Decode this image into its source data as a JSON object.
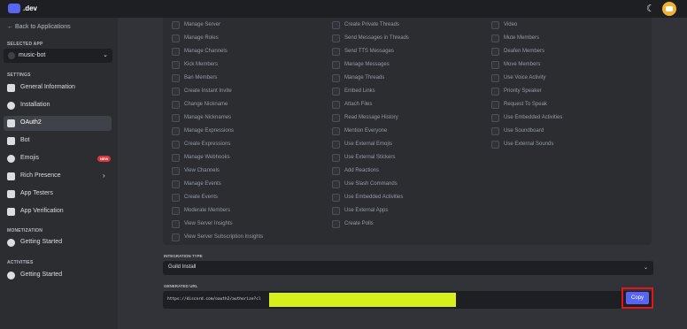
{
  "brand": {
    "logo_text": ".dev"
  },
  "header": {
    "theme_icon": "moon-icon",
    "avatar_icon": "avatar"
  },
  "sidebar": {
    "back_label": "← Back to Applications",
    "selected_app_label": "SELECTED APP",
    "selected_app": "music-bot",
    "settings_label": "SETTINGS",
    "settings_items": [
      {
        "label": "General Information",
        "icon": "home-icon"
      },
      {
        "label": "Installation",
        "icon": "gear-icon"
      },
      {
        "label": "OAuth2",
        "icon": "wrench-icon",
        "active": true
      },
      {
        "label": "Bot",
        "icon": "bot-icon"
      },
      {
        "label": "Emojis",
        "icon": "emoji-icon",
        "badge": "NEW"
      },
      {
        "label": "Rich Presence",
        "icon": "presence-icon",
        "expandable": true
      },
      {
        "label": "App Testers",
        "icon": "testers-icon"
      },
      {
        "label": "App Verification",
        "icon": "verification-icon"
      }
    ],
    "monetization_label": "MONETIZATION",
    "monetization_items": [
      {
        "label": "Getting Started",
        "icon": "plus-circle-icon"
      }
    ],
    "activities_label": "ACTIVITIES",
    "activities_items": [
      {
        "label": "Getting Started",
        "icon": "plus-circle-icon"
      }
    ]
  },
  "scopes": {
    "column1": [
      "Manage Server",
      "Manage Roles",
      "Manage Channels",
      "Kick Members",
      "Ban Members",
      "Create Instant Invite",
      "Change Nickname",
      "Manage Nicknames",
      "Manage Expressions",
      "Create Expressions",
      "Manage Webhooks",
      "View Channels",
      "Manage Events",
      "Create Events",
      "Moderate Members",
      "View Server Insights",
      "View Server Subscription Insights"
    ],
    "column2": [
      "Create Private Threads",
      "Send Messages in Threads",
      "Send TTS Messages",
      "Manage Messages",
      "Manage Threads",
      "Embed Links",
      "Attach Files",
      "Read Message History",
      "Mention Everyone",
      "Use External Emojis",
      "Use External Stickers",
      "Add Reactions",
      "Use Slash Commands",
      "Use Embedded Activities",
      "Use External Apps",
      "Create Polls"
    ],
    "column3": [
      "Video",
      "Mute Members",
      "Deafen Members",
      "Move Members",
      "Use Voice Activity",
      "Priority Speaker",
      "Request To Speak",
      "Use Embedded Activities",
      "Use Soundboard",
      "Use External Sounds"
    ]
  },
  "integration": {
    "label": "INTEGRATION TYPE",
    "value": "Guild Install"
  },
  "generated_url": {
    "label": "GENERATED URL",
    "value": "https://discord.com/oauth2/authorize?cl",
    "copy_label": "Copy"
  },
  "colors": {
    "accent": "#5865f2",
    "highlight_outline": "#e5161b",
    "redaction": "#d7ef1a"
  }
}
